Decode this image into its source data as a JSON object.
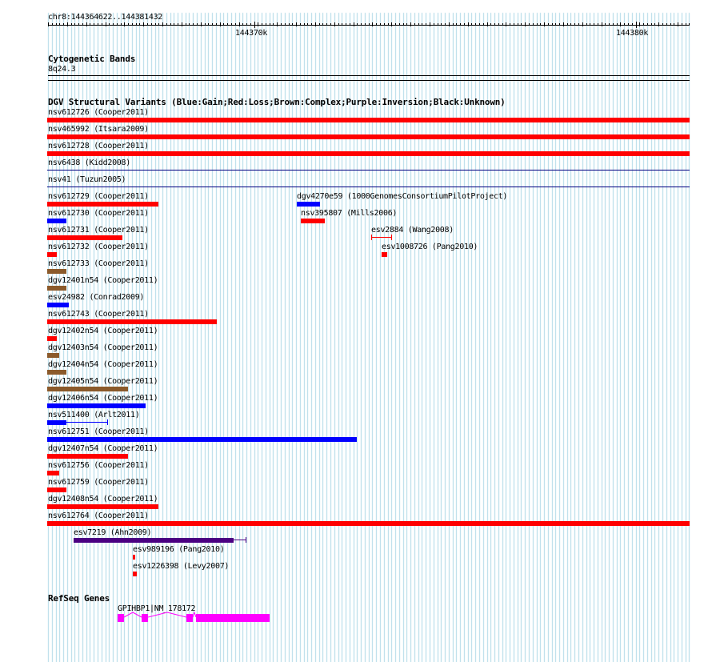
{
  "ruler": {
    "location": "chr8:144364622..144381432",
    "labels": [
      "144370k",
      "144380k"
    ]
  },
  "cytobands": {
    "title": "Cytogenetic Bands",
    "band": "8q24.3"
  },
  "dgv": {
    "title": "DGV Structural Variants (Blue:Gain;Red:Loss;Brown:Complex;Purple:Inversion;Black:Unknown)",
    "colors": {
      "gain": "#ff0000",
      "loss": "#ff0000",
      "red": "#ff0000",
      "blue": "#0000ff",
      "brown": "#8b5a2b",
      "purple": "#4b0082",
      "navy": "#000080"
    },
    "variants": [
      {
        "label": "nsv612726 (Cooper2011)",
        "color": "red"
      },
      {
        "label": "nsv465992 (Itsara2009)",
        "color": "red"
      },
      {
        "label": "nsv612728 (Cooper2011)",
        "color": "red"
      },
      {
        "label": "nsv6438 (Kidd2008)",
        "color": "navy"
      },
      {
        "label": "nsv41 (Tuzun2005)",
        "color": "navy"
      },
      {
        "label": "nsv612729 (Cooper2011)",
        "color": "red"
      },
      {
        "label": "dgv4270e59 (1000GenomesConsortiumPilotProject)",
        "color": "blue"
      },
      {
        "label": "nsv612730 (Cooper2011)",
        "color": "blue"
      },
      {
        "label": "nsv395807 (Mills2006)",
        "color": "red"
      },
      {
        "label": "nsv612731 (Cooper2011)",
        "color": "red"
      },
      {
        "label": "esv2884 (Wang2008)",
        "color": "red"
      },
      {
        "label": "nsv612732 (Cooper2011)",
        "color": "red"
      },
      {
        "label": "esv1008726 (Pang2010)",
        "color": "red"
      },
      {
        "label": "nsv612733 (Cooper2011)",
        "color": "brown"
      },
      {
        "label": "dgv12401n54 (Cooper2011)",
        "color": "brown"
      },
      {
        "label": "esv24982 (Conrad2009)",
        "color": "blue"
      },
      {
        "label": "nsv612743 (Cooper2011)",
        "color": "red"
      },
      {
        "label": "dgv12402n54 (Cooper2011)",
        "color": "red"
      },
      {
        "label": "dgv12403n54 (Cooper2011)",
        "color": "brown"
      },
      {
        "label": "dgv12404n54 (Cooper2011)",
        "color": "brown"
      },
      {
        "label": "dgv12405n54 (Cooper2011)",
        "color": "brown"
      },
      {
        "label": "dgv12406n54 (Cooper2011)",
        "color": "blue"
      },
      {
        "label": "nsv511400 (Arlt2011)",
        "color": "blue"
      },
      {
        "label": "nsv612751 (Cooper2011)",
        "color": "blue"
      },
      {
        "label": "dgv12407n54 (Cooper2011)",
        "color": "red"
      },
      {
        "label": "nsv612756 (Cooper2011)",
        "color": "red"
      },
      {
        "label": "nsv612759 (Cooper2011)",
        "color": "red"
      },
      {
        "label": "dgv12408n54 (Cooper2011)",
        "color": "red"
      },
      {
        "label": "nsv612764 (Cooper2011)",
        "color": "red"
      },
      {
        "label": "esv7219 (Ahn2009)",
        "color": "purple"
      },
      {
        "label": "esv989196 (Pang2010)",
        "color": "red"
      },
      {
        "label": "esv1226398 (Levy2007)",
        "color": "red"
      }
    ]
  },
  "refseq": {
    "title": "RefSeq Genes",
    "gene_label": "GPIHBP1|NM_178172",
    "gene_color": "#ff00ff"
  },
  "grid_color": "#add8e6"
}
